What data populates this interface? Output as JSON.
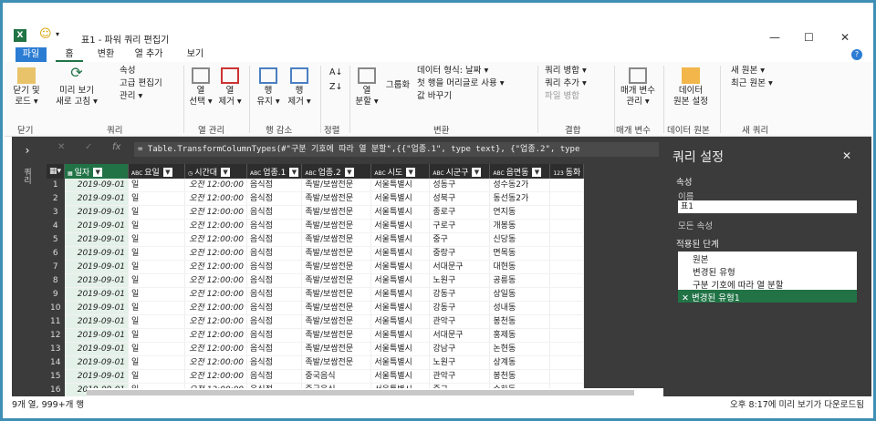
{
  "title": "표1 - 파워 쿼리 편집기",
  "tabs": [
    "파일",
    "홈",
    "변환",
    "열 추가",
    "보기"
  ],
  "ribbon": {
    "close_load": "닫기 및\n로드 ▾",
    "refresh": "미리 보기\n새로 고침 ▾",
    "props": "속성",
    "adv": "고급 편집기",
    "manage": "관리 ▾",
    "selcols": "열\n선택 ▾",
    "remcols": "열\n제거 ▾",
    "keeprows": "행\n유지 ▾",
    "remrows": "행\n제거 ▾",
    "splitcol": "열\n분할 ▾",
    "groupby": "그룹화",
    "dtype": "데이터 형식: 날짜 ▾",
    "firstrow": "첫 행을 머리글로 사용 ▾",
    "replace": "값 바꾸기",
    "merge": "쿼리 병합 ▾",
    "append": "쿼리 추가 ▾",
    "combine": "파일 병합",
    "params": "매개 변수\n관리 ▾",
    "dsrc": "데이터\n원본 설정",
    "newsrc": "새 원본 ▾",
    "recent": "최근 원본 ▾",
    "groups": [
      "닫기",
      "쿼리",
      "열 관리",
      "행 감소",
      "정렬",
      "변환",
      "결합",
      "매개 변수",
      "데이터 원본",
      "새 쿼리"
    ]
  },
  "left": "쿼리",
  "formula": "= Table.TransformColumnTypes(#\"구분 기호에 따라 열 분할\",{{\"업종.1\", type text}, {\"업종.2\", type",
  "columns": [
    "일자",
    "요일",
    "시간대",
    "업종.1",
    "업종.2",
    "시도",
    "시군구",
    "읍면동",
    "동화"
  ],
  "rows": [
    [
      "2019-09-01",
      "일",
      "오전 12:00:00",
      "음식점",
      "족발/보쌈전문",
      "서울특별시",
      "성동구",
      "성수동2가"
    ],
    [
      "2019-09-01",
      "일",
      "오전 12:00:00",
      "음식점",
      "족발/보쌈전문",
      "서울특별시",
      "성북구",
      "동선동2가"
    ],
    [
      "2019-09-01",
      "일",
      "오전 12:00:00",
      "음식점",
      "족발/보쌈전문",
      "서울특별시",
      "종로구",
      "연지동"
    ],
    [
      "2019-09-01",
      "일",
      "오전 12:00:00",
      "음식점",
      "족발/보쌈전문",
      "서울특별시",
      "구로구",
      "개봉동"
    ],
    [
      "2019-09-01",
      "일",
      "오전 12:00:00",
      "음식점",
      "족발/보쌈전문",
      "서울특별시",
      "중구",
      "신당동"
    ],
    [
      "2019-09-01",
      "일",
      "오전 12:00:00",
      "음식점",
      "족발/보쌈전문",
      "서울특별시",
      "중랑구",
      "면목동"
    ],
    [
      "2019-09-01",
      "일",
      "오전 12:00:00",
      "음식점",
      "족발/보쌈전문",
      "서울특별시",
      "서대문구",
      "대현동"
    ],
    [
      "2019-09-01",
      "일",
      "오전 12:00:00",
      "음식점",
      "족발/보쌈전문",
      "서울특별시",
      "노원구",
      "공릉동"
    ],
    [
      "2019-09-01",
      "일",
      "오전 12:00:00",
      "음식점",
      "족발/보쌈전문",
      "서울특별시",
      "강동구",
      "상일동"
    ],
    [
      "2019-09-01",
      "일",
      "오전 12:00:00",
      "음식점",
      "족발/보쌈전문",
      "서울특별시",
      "강동구",
      "성내동"
    ],
    [
      "2019-09-01",
      "일",
      "오전 12:00:00",
      "음식점",
      "족발/보쌈전문",
      "서울특별시",
      "관악구",
      "봉천동"
    ],
    [
      "2019-09-01",
      "일",
      "오전 12:00:00",
      "음식점",
      "족발/보쌈전문",
      "서울특별시",
      "서대문구",
      "홍제동"
    ],
    [
      "2019-09-01",
      "일",
      "오전 12:00:00",
      "음식점",
      "족발/보쌈전문",
      "서울특별시",
      "강남구",
      "논현동"
    ],
    [
      "2019-09-01",
      "일",
      "오전 12:00:00",
      "음식점",
      "족발/보쌈전문",
      "서울특별시",
      "노원구",
      "상계동"
    ],
    [
      "2019-09-01",
      "일",
      "오전 12:00:00",
      "음식점",
      "중국음식",
      "서울특별시",
      "관악구",
      "봉천동"
    ],
    [
      "2019-09-01",
      "일",
      "오전 12:00:00",
      "음식점",
      "중국음식",
      "서울특별시",
      "중구",
      "수하동"
    ],
    [
      "2019-09-01",
      "일",
      "오전 12:00:00",
      "음식점",
      "중국음식",
      "서울특별시",
      "중구",
      "신당동"
    ],
    [
      "2019-09-01",
      "일",
      "오전 12:00:00",
      "음식점",
      "중국음식",
      "서울특별시",
      "노원구",
      "공릉동"
    ]
  ],
  "panel": {
    "title": "쿼리 설정",
    "props": "속성",
    "name_label": "이름",
    "name_val": "표1",
    "allprops": "모든 속성",
    "steps_title": "적용된 단계",
    "steps": [
      "원본",
      "변경된 유형",
      "구분 기호에 따라 열 분할",
      "변경된 유형1"
    ]
  },
  "status": {
    "left": "9개 열, 999+개 행",
    "right": "오후 8:17에 미리 보기가 다운로드됨"
  }
}
